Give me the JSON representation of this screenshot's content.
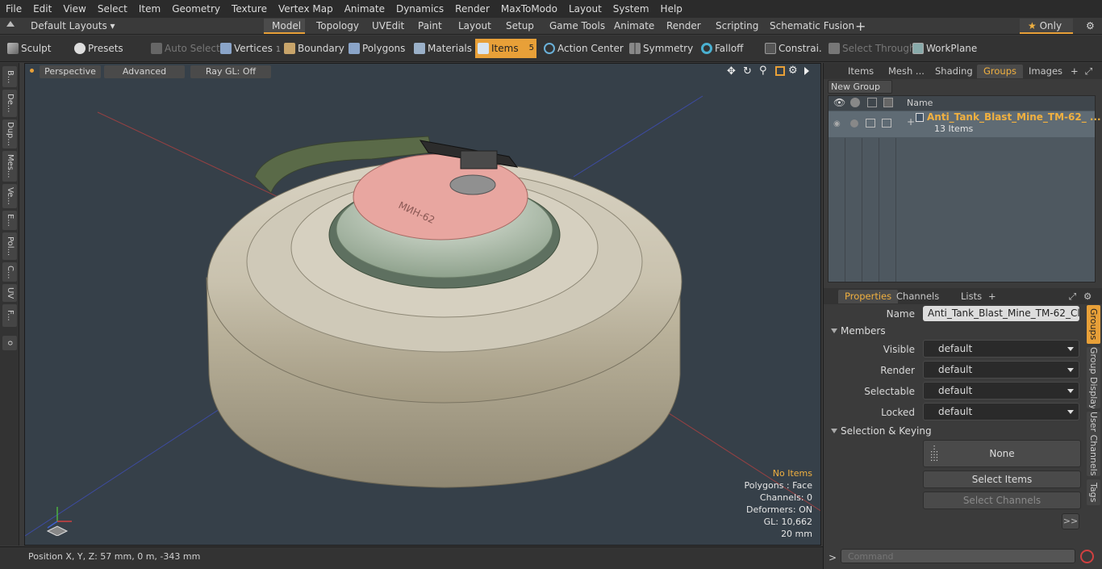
{
  "menu": [
    "File",
    "Edit",
    "View",
    "Select",
    "Item",
    "Geometry",
    "Texture",
    "Vertex Map",
    "Animate",
    "Dynamics",
    "Render",
    "MaxToModo",
    "Layout",
    "System",
    "Help"
  ],
  "layout": {
    "default_layouts": "Default Layouts",
    "tabs": [
      "Model",
      "Topology",
      "UVEdit",
      "Paint",
      "Layout",
      "Setup",
      "Game Tools",
      "Animate",
      "Render",
      "Scripting",
      "Schematic Fusion"
    ],
    "active_tab": "Model",
    "only_label": "Only"
  },
  "toolbar": {
    "sculpt": "Sculpt",
    "presets": "Presets",
    "auto_select": "Auto Select",
    "vertices": "Vertices",
    "vertices_count": "1",
    "boundary": "Boundary",
    "polygons": "Polygons",
    "materials": "Materials",
    "items": "Items",
    "items_count": "5",
    "action_center": "Action Center",
    "symmetry": "Symmetry",
    "falloff": "Falloff",
    "constraints": "Constrai...",
    "select_through": "Select Through",
    "workplane": "WorkPlane"
  },
  "left_tabs": [
    "B...",
    "De...",
    "Dup...",
    "Mes...",
    "Ve...",
    "E...",
    "Pol...",
    "C...",
    "UV",
    "F..."
  ],
  "viewport": {
    "perspective": "Perspective",
    "advanced": "Advanced",
    "raygl": "Ray GL: Off",
    "stats": {
      "items": "No Items",
      "polygons": "Polygons : Face",
      "channels": "Channels: 0",
      "deformers": "Deformers: ON",
      "gl": "GL: 10,662",
      "scale": "20 mm"
    },
    "decal_text": "МИН-62"
  },
  "status": {
    "position": "Position X, Y, Z:  57 mm, 0 m, -343 mm"
  },
  "panel": {
    "top_tabs": [
      "Items",
      "Mesh ...",
      "Shading",
      "Groups",
      "Images"
    ],
    "top_active": "Groups",
    "new_group": "New Group",
    "name_col": "Name",
    "group_name": "Anti_Tank_Blast_Mine_TM-62_ ...",
    "group_count": "13 Items",
    "bottom_tabs": [
      "Properties",
      "Channels",
      "Lists"
    ],
    "bottom_active": "Properties",
    "name_label": "Name",
    "name_value": "Anti_Tank_Blast_Mine_TM-62_Clean (",
    "members": "Members",
    "visible_label": "Visible",
    "render_label": "Render",
    "selectable_label": "Selectable",
    "locked_label": "Locked",
    "default_value": "default",
    "selection_keying": "Selection & Keying",
    "none_label": "None",
    "select_items": "Select Items",
    "select_channels": "Select Channels",
    "more": ">>",
    "command_placeholder": "Command",
    "side_tabs": [
      "Groups",
      "Group Display",
      "User Channels",
      "Tags"
    ]
  }
}
